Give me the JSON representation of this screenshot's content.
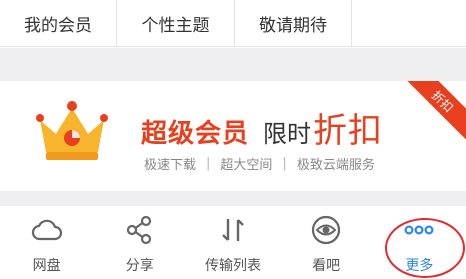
{
  "top_menu": {
    "items": [
      {
        "label": "我的会员"
      },
      {
        "label": "个性主题"
      },
      {
        "label": "敬请期待"
      },
      {
        "label": ""
      }
    ]
  },
  "banner": {
    "vip_label": "超级会员",
    "limited_label": "限时",
    "discount_label": "折扣",
    "ribbon_label": "折扣",
    "features": [
      "极速下载",
      "超大空间",
      "极致云端服务"
    ],
    "separator": "|",
    "crown_icon": "crown-icon",
    "accent_color": "#e8401f",
    "crown_color": "#f7b42c"
  },
  "bottom_nav": {
    "items": [
      {
        "label": "网盘",
        "icon": "cloud-icon"
      },
      {
        "label": "分享",
        "icon": "share-icon"
      },
      {
        "label": "传输列表",
        "icon": "transfer-icon"
      },
      {
        "label": "看吧",
        "icon": "eye-icon"
      },
      {
        "label": "更多",
        "icon": "more-dots-icon"
      }
    ],
    "active_color": "#2a88e6",
    "highlight_color": "#e02c2c"
  }
}
